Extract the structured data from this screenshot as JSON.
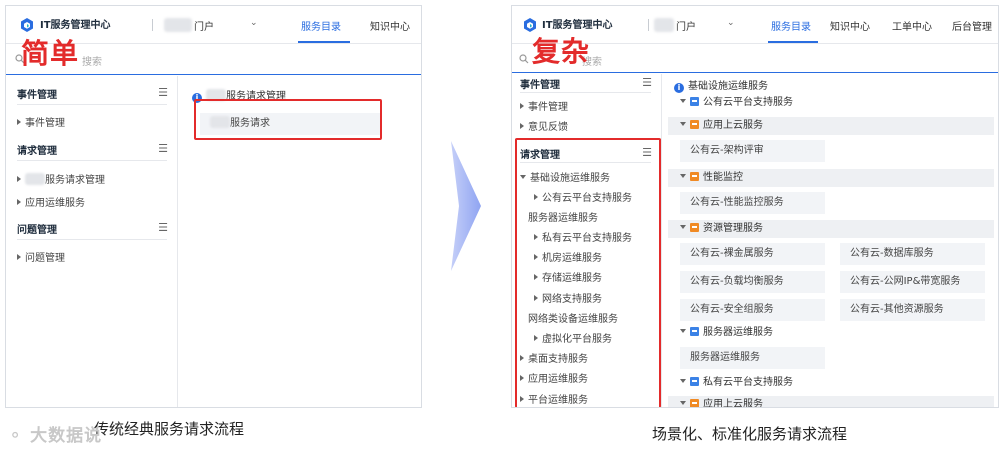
{
  "colors": {
    "accent": "#2a6de0",
    "highlight_red": "#e32b2b",
    "orange": "#f08a24",
    "tile_bg": "#f2f4f7"
  },
  "left": {
    "tag": "简单",
    "app_title": "IT服务管理中心",
    "portal_suffix": "门户",
    "nav": [
      "服务目录",
      "知识中心"
    ],
    "search_placeholder": "搜索",
    "sidebar_groups": [
      {
        "title": "事件管理",
        "items": [
          "事件管理"
        ]
      },
      {
        "title": "请求管理",
        "items": [
          "服务请求管理",
          "应用运维服务"
        ]
      },
      {
        "title": "问题管理",
        "items": [
          "问题管理"
        ]
      }
    ],
    "section_title": "服务请求管理",
    "service_card": "服务请求",
    "collapse_icon": "collapse-list-icon"
  },
  "right": {
    "tag": "复杂",
    "app_title": "IT服务管理中心",
    "portal_suffix": "门户",
    "nav": [
      "服务目录",
      "知识中心",
      "工单中心",
      "后台管理"
    ],
    "search_placeholder": "搜索",
    "sidebar_top_group": {
      "title": "事件管理",
      "items": [
        "事件管理",
        "意见反馈"
      ]
    },
    "sidebar_request_group": {
      "title": "请求管理",
      "items": [
        {
          "label": "基础设施运维服务",
          "expanded": true
        },
        {
          "label": "公有云平台支持服务",
          "level": 2
        },
        {
          "label": "服务器运维服务",
          "level": 1,
          "plain": true
        },
        {
          "label": "私有云平台支持服务",
          "level": 2
        },
        {
          "label": "机房运维服务",
          "level": 2
        },
        {
          "label": "存储运维服务",
          "level": 2
        },
        {
          "label": "网络支持服务",
          "level": 2
        },
        {
          "label": "网络类设备运维服务",
          "level": 1,
          "plain": true
        },
        {
          "label": "虚拟化平台服务",
          "level": 2
        },
        {
          "label": "桌面支持服务",
          "level": 0
        },
        {
          "label": "应用运维服务",
          "level": 0
        },
        {
          "label": "平台运维服务",
          "level": 0
        }
      ]
    },
    "section_title": "基础设施运维服务",
    "categories": [
      {
        "label": "公有云平台支持服务",
        "icon": "blue",
        "highlight": false,
        "cards": []
      },
      {
        "label": "应用上云服务",
        "icon": "orange",
        "highlight": true,
        "cards": [
          "公有云-架构评审"
        ]
      },
      {
        "label": "性能监控",
        "icon": "orange",
        "highlight": true,
        "cards": [
          "公有云-性能监控服务"
        ]
      },
      {
        "label": "资源管理服务",
        "icon": "orange",
        "highlight": true,
        "cards": [
          "公有云-裸金属服务",
          "公有云-数据库服务",
          "公有云-负载均衡服务",
          "公有云-公网IP&带宽服务",
          "公有云-安全组服务",
          "公有云-其他资源服务"
        ]
      },
      {
        "label": "服务器运维服务",
        "icon": "blue",
        "highlight": false,
        "cards": [
          "服务器运维服务"
        ]
      },
      {
        "label": "私有云平台支持服务",
        "icon": "blue",
        "highlight": false,
        "cards": []
      },
      {
        "label": "应用上云服务",
        "icon": "orange",
        "highlight": true,
        "cards": []
      }
    ]
  },
  "captions": {
    "left": "传统经典服务请求流程",
    "right": "场景化、标准化服务请求流程"
  },
  "watermark": "大数据说"
}
